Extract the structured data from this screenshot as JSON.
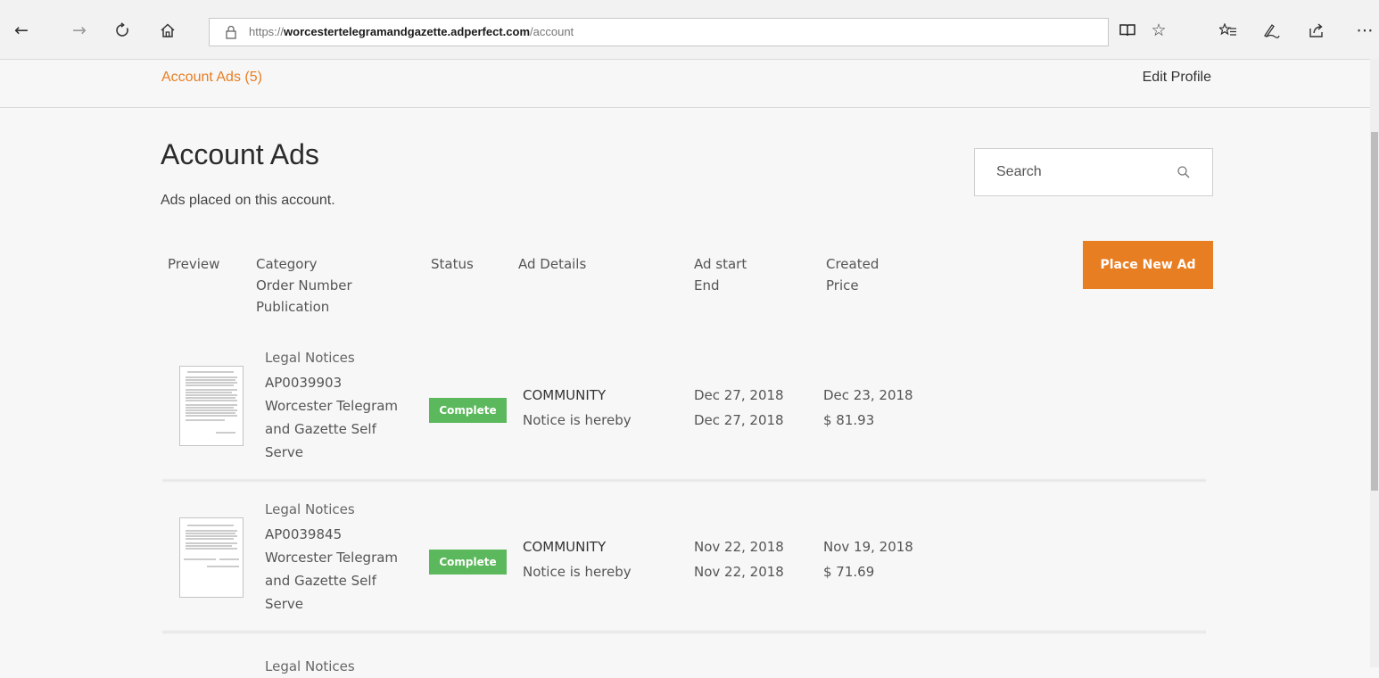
{
  "browser": {
    "url_prefix": "https://",
    "url_host": "worcestertelegramandgazette.adperfect.com",
    "url_path": "/account"
  },
  "nav": {
    "account_ads_link": "Account Ads (5)",
    "edit_profile_link": "Edit Profile"
  },
  "page": {
    "title": "Account Ads",
    "subtitle": "Ads placed on this account.",
    "search_placeholder": "Search",
    "place_new_ad_label": "Place New Ad"
  },
  "table": {
    "headers": {
      "preview": "Preview",
      "category": "Category\nOrder Number\nPublication",
      "status": "Status",
      "ad_details": "Ad Details",
      "ad_dates": "Ad start\nEnd",
      "created_price": "Created\nPrice"
    },
    "rows": [
      {
        "category": "Legal Notices",
        "order_number": "AP0039903",
        "publication_line1": "Worcester Telegram",
        "publication_line2": "and Gazette Self",
        "publication_line3": "Serve",
        "status": "Complete",
        "details_title": "COMMUNITY",
        "details_text": "Notice is hereby",
        "ad_start": "Dec 27, 2018",
        "ad_end": "Dec 27, 2018",
        "created": "Dec 23, 2018",
        "price": "$ 81.93"
      },
      {
        "category": "Legal Notices",
        "order_number": "AP0039845",
        "publication_line1": "Worcester Telegram",
        "publication_line2": "and Gazette Self",
        "publication_line3": "Serve",
        "status": "Complete",
        "details_title": "COMMUNITY",
        "details_text": "Notice is hereby",
        "ad_start": "Nov 22, 2018",
        "ad_end": "Nov 22, 2018",
        "created": "Nov 19, 2018",
        "price": "$ 71.69"
      },
      {
        "category": "Legal Notices"
      }
    ]
  },
  "colors": {
    "accent": "#e87e22",
    "complete_badge": "#5cb85c"
  },
  "icons": [
    "back-icon",
    "forward-icon",
    "refresh-icon",
    "home-icon",
    "lock-icon",
    "reading-view-icon",
    "favorite-star-icon",
    "favorites-list-icon",
    "pen-icon",
    "share-icon",
    "more-icon",
    "search-icon"
  ]
}
